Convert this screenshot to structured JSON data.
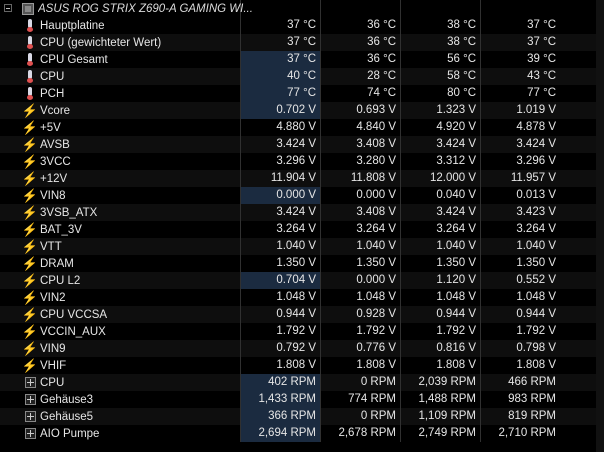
{
  "header": {
    "device": "ASUS ROG STRIX Z690-A GAMING WI...",
    "icon": "chip-icon"
  },
  "rows": [
    {
      "name": "Hauptplatine",
      "icon": "thermometer",
      "values": [
        "37 °C",
        "36 °C",
        "38 °C",
        "37 °C"
      ],
      "hl": false
    },
    {
      "name": "CPU (gewichteter Wert)",
      "icon": "thermometer",
      "values": [
        "37 °C",
        "36 °C",
        "38 °C",
        "37 °C"
      ],
      "hl": false
    },
    {
      "name": "CPU Gesamt",
      "icon": "thermometer",
      "values": [
        "37 °C",
        "36 °C",
        "56 °C",
        "39 °C"
      ],
      "hl": true
    },
    {
      "name": "CPU",
      "icon": "thermometer",
      "values": [
        "40 °C",
        "28 °C",
        "58 °C",
        "43 °C"
      ],
      "hl": true
    },
    {
      "name": "PCH",
      "icon": "thermometer",
      "values": [
        "77 °C",
        "74 °C",
        "80 °C",
        "77 °C"
      ],
      "hl": true
    },
    {
      "name": "Vcore",
      "icon": "bolt",
      "values": [
        "0.702 V",
        "0.693 V",
        "1.323 V",
        "1.019 V"
      ],
      "hl": true
    },
    {
      "name": "+5V",
      "icon": "bolt",
      "values": [
        "4.880 V",
        "4.840 V",
        "4.920 V",
        "4.878 V"
      ],
      "hl": false
    },
    {
      "name": "AVSB",
      "icon": "bolt",
      "values": [
        "3.424 V",
        "3.408 V",
        "3.424 V",
        "3.424 V"
      ],
      "hl": false
    },
    {
      "name": "3VCC",
      "icon": "bolt",
      "values": [
        "3.296 V",
        "3.280 V",
        "3.312 V",
        "3.296 V"
      ],
      "hl": false
    },
    {
      "name": "+12V",
      "icon": "bolt",
      "values": [
        "11.904 V",
        "11.808 V",
        "12.000 V",
        "11.957 V"
      ],
      "hl": false
    },
    {
      "name": "VIN8",
      "icon": "bolt",
      "values": [
        "0.000 V",
        "0.000 V",
        "0.040 V",
        "0.013 V"
      ],
      "hl": true
    },
    {
      "name": "3VSB_ATX",
      "icon": "bolt",
      "values": [
        "3.424 V",
        "3.408 V",
        "3.424 V",
        "3.423 V"
      ],
      "hl": false
    },
    {
      "name": "BAT_3V",
      "icon": "bolt",
      "values": [
        "3.264 V",
        "3.264 V",
        "3.264 V",
        "3.264 V"
      ],
      "hl": false
    },
    {
      "name": "VTT",
      "icon": "bolt",
      "values": [
        "1.040 V",
        "1.040 V",
        "1.040 V",
        "1.040 V"
      ],
      "hl": false
    },
    {
      "name": "DRAM",
      "icon": "bolt",
      "values": [
        "1.350 V",
        "1.350 V",
        "1.350 V",
        "1.350 V"
      ],
      "hl": false
    },
    {
      "name": "CPU L2",
      "icon": "bolt",
      "values": [
        "0.704 V",
        "0.000 V",
        "1.120 V",
        "0.552 V"
      ],
      "hl": true
    },
    {
      "name": "VIN2",
      "icon": "bolt",
      "values": [
        "1.048 V",
        "1.048 V",
        "1.048 V",
        "1.048 V"
      ],
      "hl": false
    },
    {
      "name": "CPU VCCSA",
      "icon": "bolt",
      "values": [
        "0.944 V",
        "0.928 V",
        "0.944 V",
        "0.944 V"
      ],
      "hl": false
    },
    {
      "name": "VCCIN_AUX",
      "icon": "bolt",
      "values": [
        "1.792 V",
        "1.792 V",
        "1.792 V",
        "1.792 V"
      ],
      "hl": false
    },
    {
      "name": "VIN9",
      "icon": "bolt",
      "values": [
        "0.792 V",
        "0.776 V",
        "0.816 V",
        "0.798 V"
      ],
      "hl": false
    },
    {
      "name": "VHIF",
      "icon": "bolt",
      "values": [
        "1.808 V",
        "1.808 V",
        "1.808 V",
        "1.808 V"
      ],
      "hl": false
    },
    {
      "name": "CPU",
      "icon": "fan",
      "values": [
        "402 RPM",
        "0 RPM",
        "2,039 RPM",
        "466 RPM"
      ],
      "hl": true
    },
    {
      "name": "Gehäuse3",
      "icon": "fan",
      "values": [
        "1,433 RPM",
        "774 RPM",
        "1,488 RPM",
        "983 RPM"
      ],
      "hl": true
    },
    {
      "name": "Gehäuse5",
      "icon": "fan",
      "values": [
        "366 RPM",
        "0 RPM",
        "1,109 RPM",
        "819 RPM"
      ],
      "hl": true
    },
    {
      "name": "AIO Pumpe",
      "icon": "fan",
      "values": [
        "2,694 RPM",
        "2,678 RPM",
        "2,749 RPM",
        "2,710 RPM"
      ],
      "hl": true
    }
  ],
  "colors": {
    "background": "#000000",
    "highlight": "#1b2b40",
    "bolt": "#f2c200"
  }
}
